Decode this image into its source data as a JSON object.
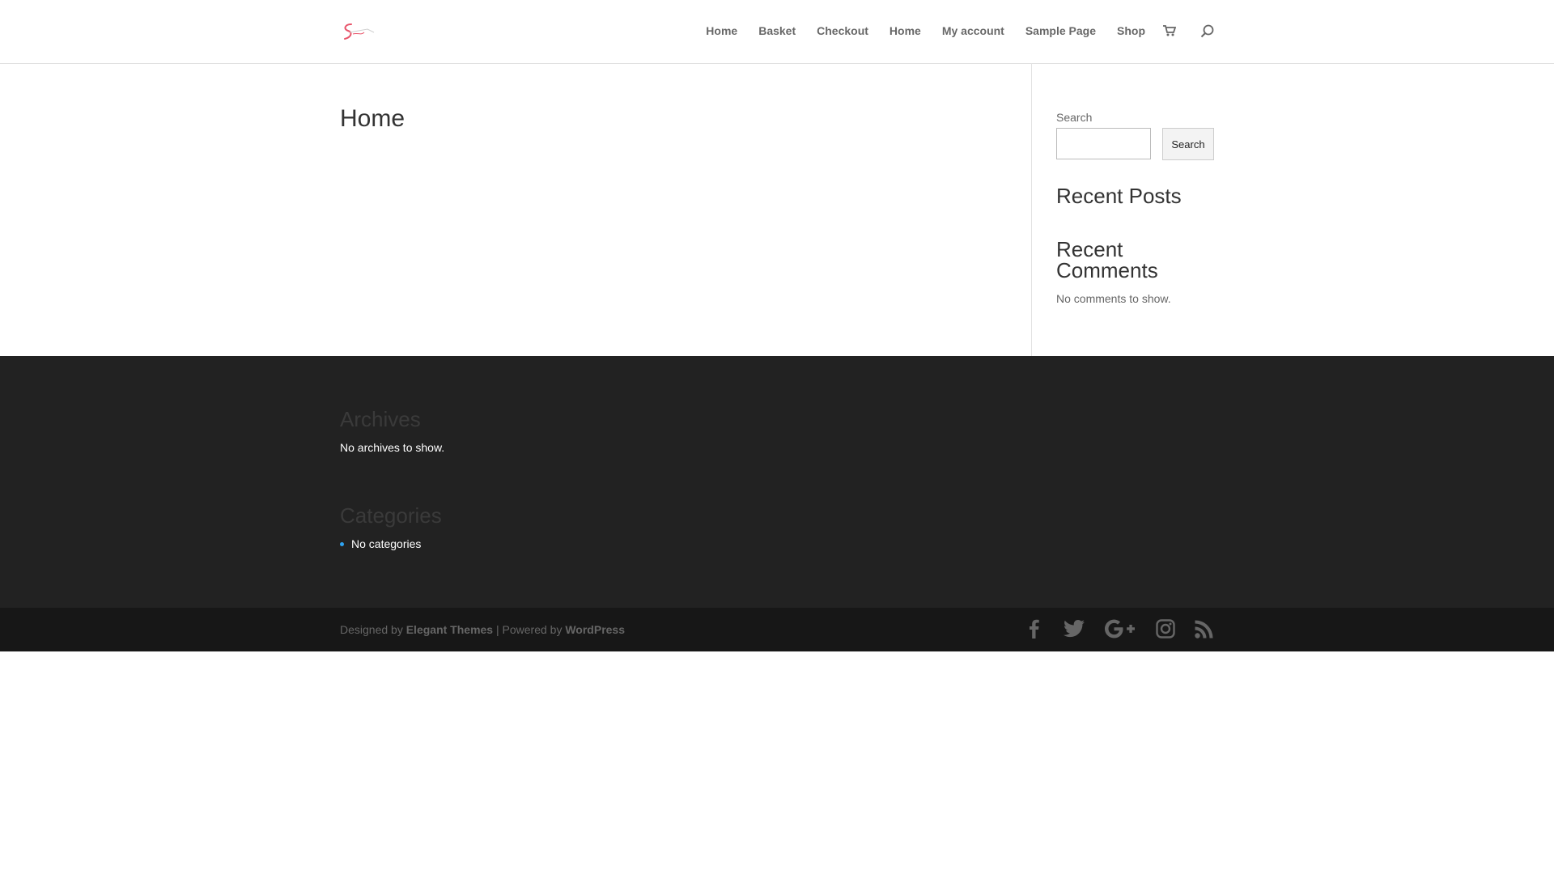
{
  "header": {
    "nav": [
      {
        "label": "Home"
      },
      {
        "label": "Basket"
      },
      {
        "label": "Checkout"
      },
      {
        "label": "Home"
      },
      {
        "label": "My account"
      },
      {
        "label": "Sample Page"
      },
      {
        "label": "Shop"
      }
    ],
    "icons": [
      "cart-icon",
      "search-icon"
    ],
    "logo_colors": [
      "#e8546a",
      "#c9c9c9"
    ]
  },
  "main": {
    "page_title": "Home"
  },
  "sidebar": {
    "search_label": "Search",
    "search_value": "",
    "search_button": "Search",
    "recent_posts_title": "Recent Posts",
    "recent_comments_title": "Recent Comments",
    "no_comments": "No comments to show."
  },
  "footer": {
    "archives_title": "Archives",
    "archives_text": "No archives to show.",
    "categories_title": "Categories",
    "categories": [
      "No categories"
    ],
    "bullet_color": "#2ea3f2"
  },
  "bottom": {
    "designed_by": "Designed by ",
    "elegant_themes": "Elegant Themes",
    "separator": " | Powered by ",
    "wordpress": "WordPress",
    "social_icons": [
      "facebook-icon",
      "twitter-icon",
      "google-plus-icon",
      "instagram-icon",
      "rss-icon"
    ]
  }
}
